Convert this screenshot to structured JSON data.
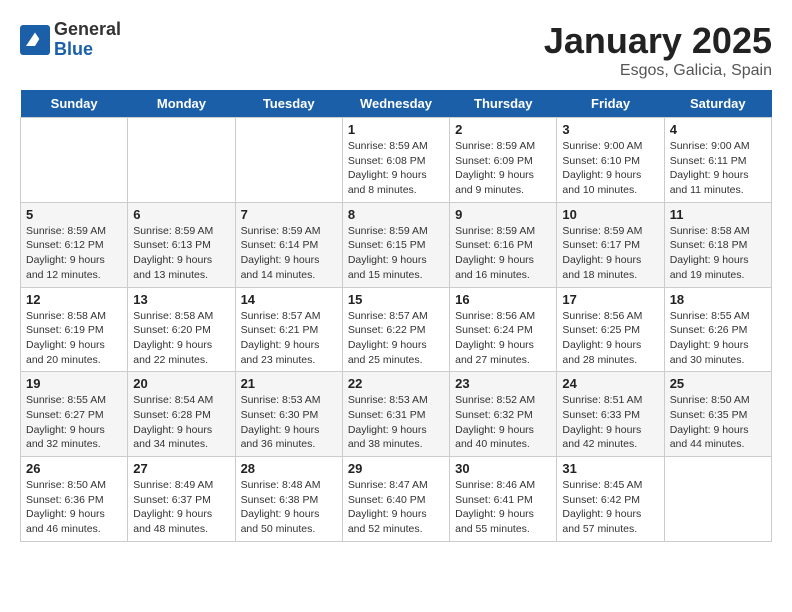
{
  "logo": {
    "general": "General",
    "blue": "Blue"
  },
  "title": "January 2025",
  "location": "Esgos, Galicia, Spain",
  "weekdays": [
    "Sunday",
    "Monday",
    "Tuesday",
    "Wednesday",
    "Thursday",
    "Friday",
    "Saturday"
  ],
  "weeks": [
    [
      {
        "day": "",
        "info": ""
      },
      {
        "day": "",
        "info": ""
      },
      {
        "day": "",
        "info": ""
      },
      {
        "day": "1",
        "info": "Sunrise: 8:59 AM\nSunset: 6:08 PM\nDaylight: 9 hours\nand 8 minutes."
      },
      {
        "day": "2",
        "info": "Sunrise: 8:59 AM\nSunset: 6:09 PM\nDaylight: 9 hours\nand 9 minutes."
      },
      {
        "day": "3",
        "info": "Sunrise: 9:00 AM\nSunset: 6:10 PM\nDaylight: 9 hours\nand 10 minutes."
      },
      {
        "day": "4",
        "info": "Sunrise: 9:00 AM\nSunset: 6:11 PM\nDaylight: 9 hours\nand 11 minutes."
      }
    ],
    [
      {
        "day": "5",
        "info": "Sunrise: 8:59 AM\nSunset: 6:12 PM\nDaylight: 9 hours\nand 12 minutes."
      },
      {
        "day": "6",
        "info": "Sunrise: 8:59 AM\nSunset: 6:13 PM\nDaylight: 9 hours\nand 13 minutes."
      },
      {
        "day": "7",
        "info": "Sunrise: 8:59 AM\nSunset: 6:14 PM\nDaylight: 9 hours\nand 14 minutes."
      },
      {
        "day": "8",
        "info": "Sunrise: 8:59 AM\nSunset: 6:15 PM\nDaylight: 9 hours\nand 15 minutes."
      },
      {
        "day": "9",
        "info": "Sunrise: 8:59 AM\nSunset: 6:16 PM\nDaylight: 9 hours\nand 16 minutes."
      },
      {
        "day": "10",
        "info": "Sunrise: 8:59 AM\nSunset: 6:17 PM\nDaylight: 9 hours\nand 18 minutes."
      },
      {
        "day": "11",
        "info": "Sunrise: 8:58 AM\nSunset: 6:18 PM\nDaylight: 9 hours\nand 19 minutes."
      }
    ],
    [
      {
        "day": "12",
        "info": "Sunrise: 8:58 AM\nSunset: 6:19 PM\nDaylight: 9 hours\nand 20 minutes."
      },
      {
        "day": "13",
        "info": "Sunrise: 8:58 AM\nSunset: 6:20 PM\nDaylight: 9 hours\nand 22 minutes."
      },
      {
        "day": "14",
        "info": "Sunrise: 8:57 AM\nSunset: 6:21 PM\nDaylight: 9 hours\nand 23 minutes."
      },
      {
        "day": "15",
        "info": "Sunrise: 8:57 AM\nSunset: 6:22 PM\nDaylight: 9 hours\nand 25 minutes."
      },
      {
        "day": "16",
        "info": "Sunrise: 8:56 AM\nSunset: 6:24 PM\nDaylight: 9 hours\nand 27 minutes."
      },
      {
        "day": "17",
        "info": "Sunrise: 8:56 AM\nSunset: 6:25 PM\nDaylight: 9 hours\nand 28 minutes."
      },
      {
        "day": "18",
        "info": "Sunrise: 8:55 AM\nSunset: 6:26 PM\nDaylight: 9 hours\nand 30 minutes."
      }
    ],
    [
      {
        "day": "19",
        "info": "Sunrise: 8:55 AM\nSunset: 6:27 PM\nDaylight: 9 hours\nand 32 minutes."
      },
      {
        "day": "20",
        "info": "Sunrise: 8:54 AM\nSunset: 6:28 PM\nDaylight: 9 hours\nand 34 minutes."
      },
      {
        "day": "21",
        "info": "Sunrise: 8:53 AM\nSunset: 6:30 PM\nDaylight: 9 hours\nand 36 minutes."
      },
      {
        "day": "22",
        "info": "Sunrise: 8:53 AM\nSunset: 6:31 PM\nDaylight: 9 hours\nand 38 minutes."
      },
      {
        "day": "23",
        "info": "Sunrise: 8:52 AM\nSunset: 6:32 PM\nDaylight: 9 hours\nand 40 minutes."
      },
      {
        "day": "24",
        "info": "Sunrise: 8:51 AM\nSunset: 6:33 PM\nDaylight: 9 hours\nand 42 minutes."
      },
      {
        "day": "25",
        "info": "Sunrise: 8:50 AM\nSunset: 6:35 PM\nDaylight: 9 hours\nand 44 minutes."
      }
    ],
    [
      {
        "day": "26",
        "info": "Sunrise: 8:50 AM\nSunset: 6:36 PM\nDaylight: 9 hours\nand 46 minutes."
      },
      {
        "day": "27",
        "info": "Sunrise: 8:49 AM\nSunset: 6:37 PM\nDaylight: 9 hours\nand 48 minutes."
      },
      {
        "day": "28",
        "info": "Sunrise: 8:48 AM\nSunset: 6:38 PM\nDaylight: 9 hours\nand 50 minutes."
      },
      {
        "day": "29",
        "info": "Sunrise: 8:47 AM\nSunset: 6:40 PM\nDaylight: 9 hours\nand 52 minutes."
      },
      {
        "day": "30",
        "info": "Sunrise: 8:46 AM\nSunset: 6:41 PM\nDaylight: 9 hours\nand 55 minutes."
      },
      {
        "day": "31",
        "info": "Sunrise: 8:45 AM\nSunset: 6:42 PM\nDaylight: 9 hours\nand 57 minutes."
      },
      {
        "day": "",
        "info": ""
      }
    ]
  ]
}
